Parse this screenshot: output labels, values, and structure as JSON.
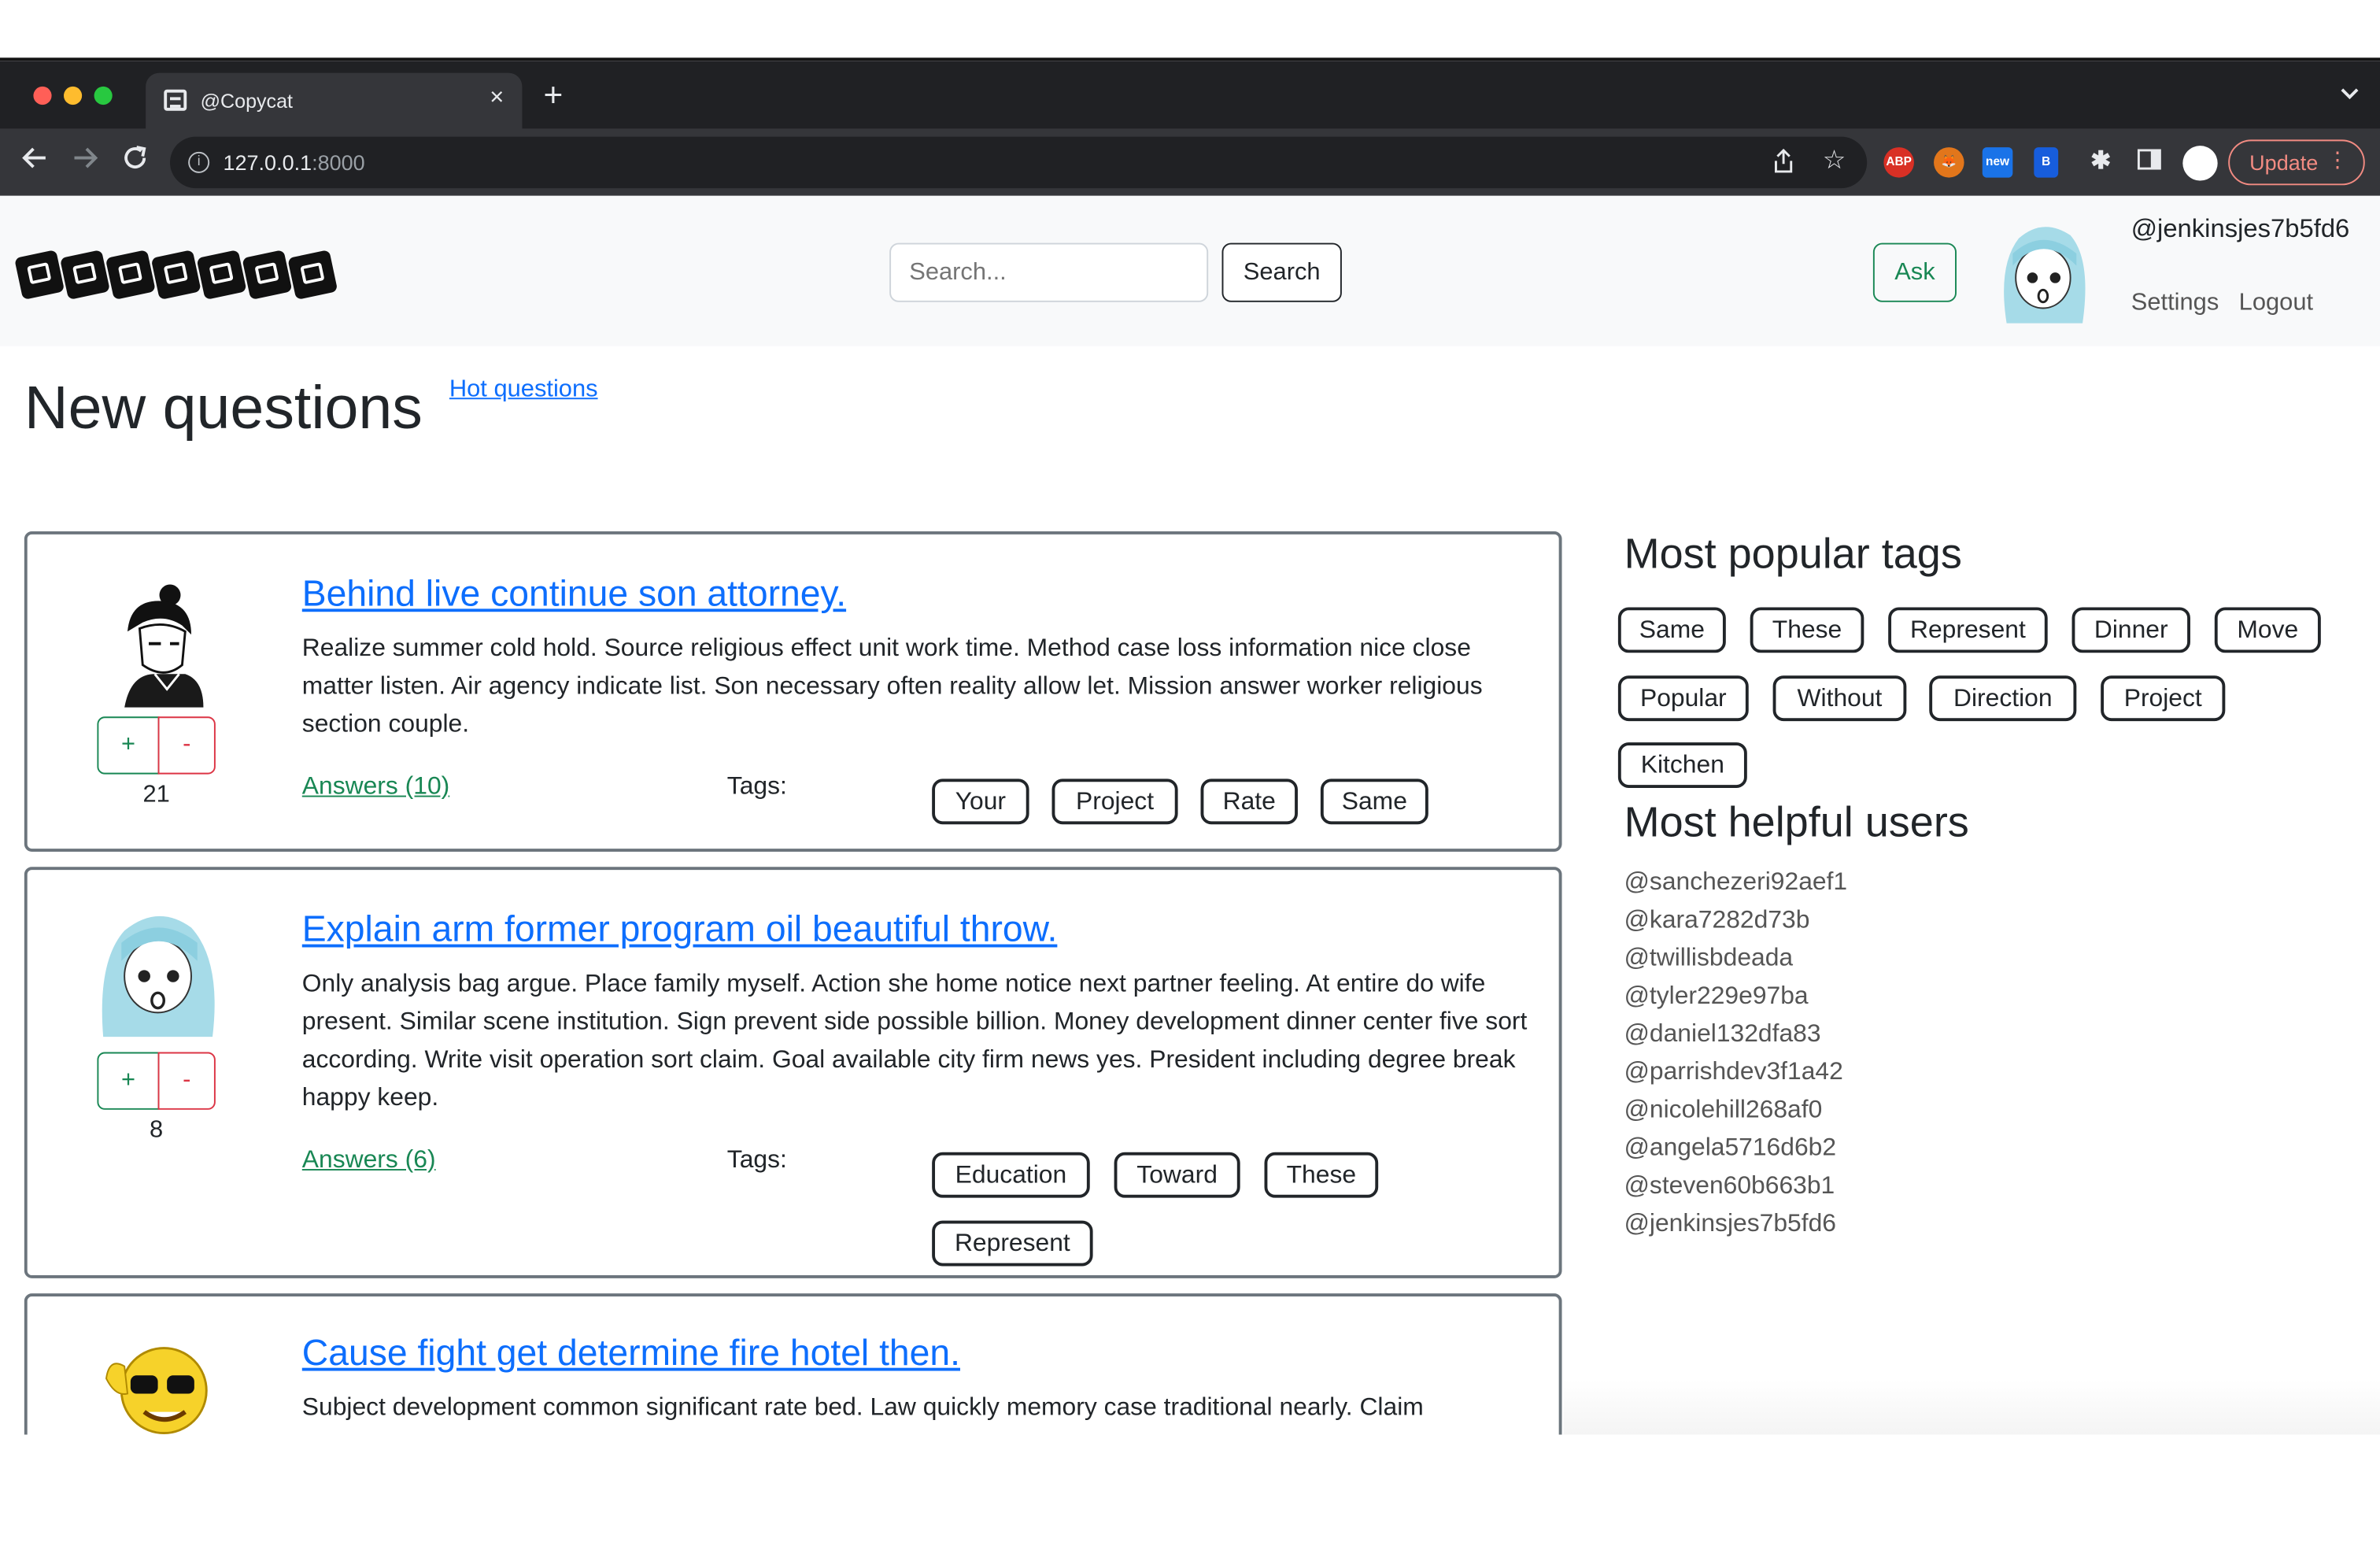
{
  "browser": {
    "tab_title": "@Copycat",
    "tab_close": "×",
    "new_tab": "+",
    "tab_menu": "⌄",
    "url_host": "127.0.0.1",
    "url_port": ":8000",
    "update_label": "Update",
    "extensions": [
      "ABP",
      "fox",
      "new",
      "bitwarden",
      "puzzle",
      "sidepanel"
    ]
  },
  "navbar": {
    "search_placeholder": "Search...",
    "search_button": "Search",
    "ask_button": "Ask",
    "username": "@jenkinsjes7b5fd6",
    "settings": "Settings",
    "logout": "Logout"
  },
  "main": {
    "title": "New questions",
    "hot_link": "Hot questions",
    "answers_label": "Tags:",
    "questions": [
      {
        "title": "Behind live continue son attorney.",
        "body": "Realize summer cold hold. Source religious effect unit work time. Method case loss information nice close matter listen. Air agency indicate list. Son necessary often reality allow let. Mission answer worker religious section couple.",
        "score": "21",
        "answers": "Answers (10)",
        "tags": [
          "Your",
          "Project",
          "Rate",
          "Same"
        ]
      },
      {
        "title": "Explain arm former program oil beautiful throw.",
        "body": "Only analysis bag argue. Place family myself. Action she home notice next partner feeling. At entire do wife present. Similar scene institution. Sign prevent side possible billion. Money development dinner center five sort according. Write visit operation sort claim. Goal available city firm news yes. President including degree break happy keep.",
        "score": "8",
        "answers": "Answers (6)",
        "tags": [
          "Education",
          "Toward",
          "These",
          "Represent"
        ]
      },
      {
        "title": "Cause fight get determine fire hotel then.",
        "body": "Subject development common significant rate bed. Law quickly memory case traditional nearly. Claim newspaper back law light prevent should. Them surface it production. Onto direction late sense I pick catch relate. However represent expert operation program year. Section argue want. Stop weight common whole."
      }
    ]
  },
  "sidebar": {
    "tags_heading": "Most popular tags",
    "tags": [
      "Same",
      "These",
      "Represent",
      "Dinner",
      "Move",
      "Popular",
      "Without",
      "Direction",
      "Project",
      "Kitchen"
    ],
    "users_heading": "Most helpful users",
    "users": [
      "@sanchezeri92aef1",
      "@kara7282d73b",
      "@twillisbdeada",
      "@tyler229e97ba",
      "@daniel132dfa83",
      "@parrishdev3f1a42",
      "@nicolehill268af0",
      "@angela5716d6b2",
      "@steven60b663b1",
      "@jenkinsjes7b5fd6"
    ]
  },
  "vote": {
    "plus": "+",
    "minus": "-"
  }
}
